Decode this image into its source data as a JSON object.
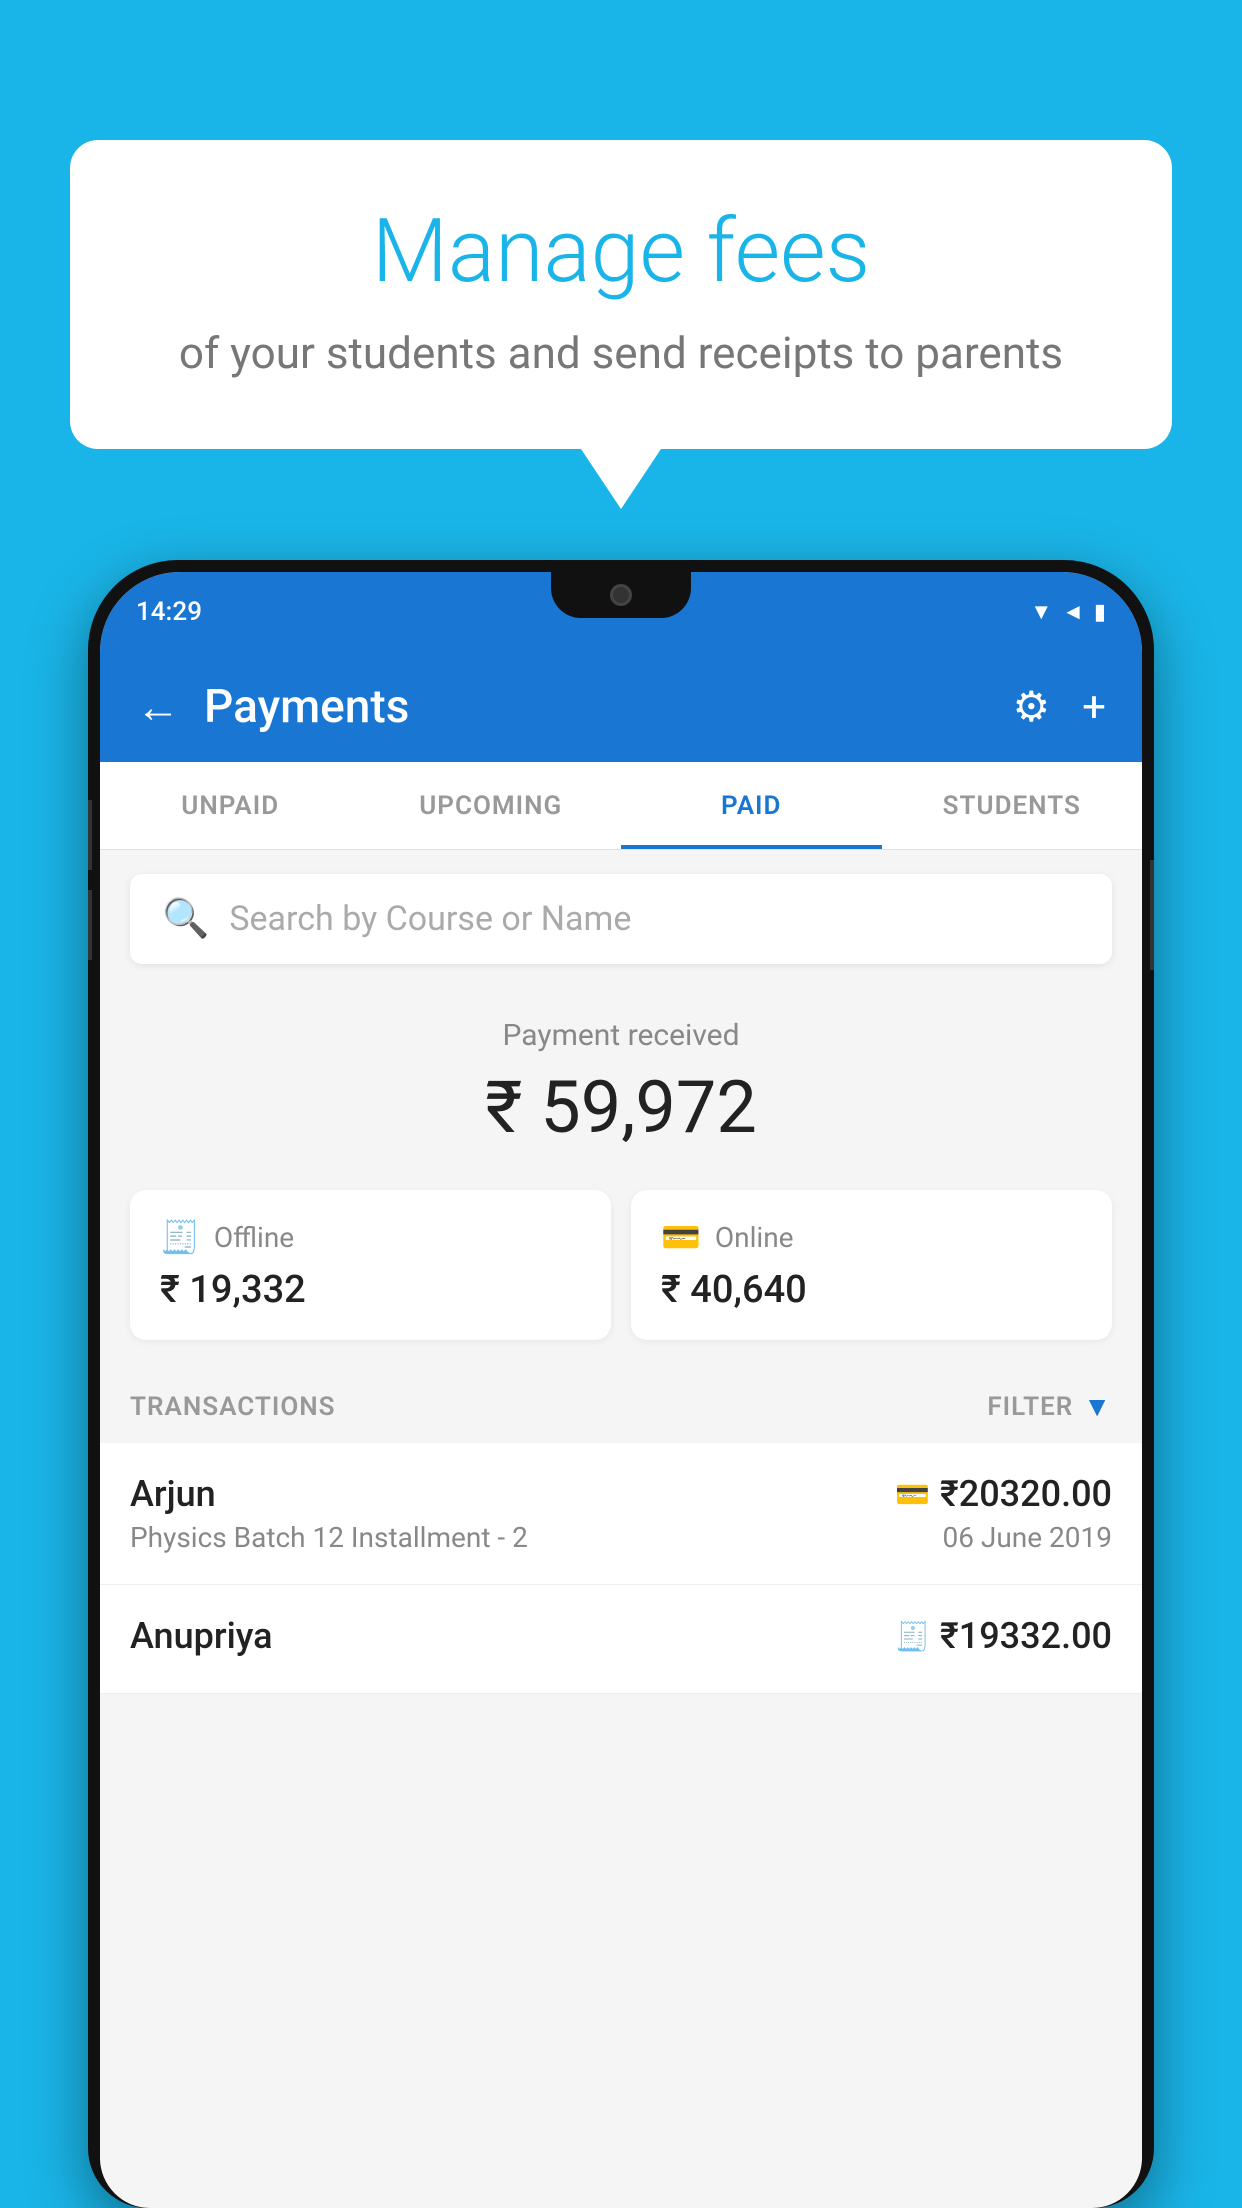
{
  "background_color": "#1ab5e8",
  "speech_bubble": {
    "title": "Manage fees",
    "subtitle": "of your students and send receipts to parents"
  },
  "phone": {
    "status_bar": {
      "time": "14:29"
    },
    "header": {
      "title": "Payments",
      "back_label": "←",
      "settings_icon": "⚙",
      "add_icon": "+"
    },
    "tabs": [
      {
        "label": "UNPAID",
        "active": false
      },
      {
        "label": "UPCOMING",
        "active": false
      },
      {
        "label": "PAID",
        "active": true
      },
      {
        "label": "STUDENTS",
        "active": false
      }
    ],
    "search": {
      "placeholder": "Search by Course or Name"
    },
    "payment_summary": {
      "label": "Payment received",
      "amount": "₹ 59,972",
      "offline": {
        "label": "Offline",
        "amount": "₹ 19,332"
      },
      "online": {
        "label": "Online",
        "amount": "₹ 40,640"
      }
    },
    "transactions": {
      "header_label": "TRANSACTIONS",
      "filter_label": "FILTER",
      "rows": [
        {
          "name": "Arjun",
          "detail": "Physics Batch 12 Installment - 2",
          "amount": "₹20320.00",
          "date": "06 June 2019",
          "payment_type": "online"
        },
        {
          "name": "Anupriya",
          "detail": "",
          "amount": "₹19332.00",
          "date": "",
          "payment_type": "offline"
        }
      ]
    }
  }
}
